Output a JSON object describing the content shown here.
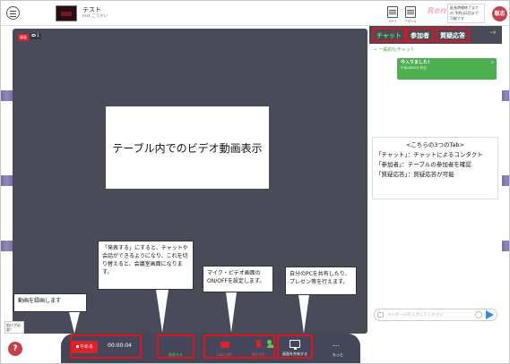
{
  "header": {
    "table_name": "テスト",
    "table_sub": "test ごうかい",
    "icon1_label": "ｱﾝｹｰﾄ",
    "icon2_label": "ﾌﾟﾛﾌｨｰﾙ",
    "logo": "Remo",
    "logo_sub": "",
    "notice": "延長時間終了まで の 予約は2回まで 可能です",
    "user_initial": "聡志"
  },
  "video": {
    "rec_tag": "録画",
    "viewer_count": "1",
    "display_text": "テーブル内でのビデオ動画表示"
  },
  "panel": {
    "tabs": [
      "チャット",
      "参加者",
      "質疑応答"
    ],
    "general_chat": "← 一般的なチャット",
    "bubble_message": "今入りました！",
    "bubble_time": "午後2時00分 昨日",
    "input_placeholder": "メッセージを入力してください",
    "callout_title": "<こちらの3つのTab>",
    "callout_lines": [
      "「チャット」：チャットによるコンタクト",
      "「参加者」：テーブルの参加者を確認",
      "「質疑応答」：質疑応答が可能"
    ]
  },
  "toolbar": {
    "stop_label": "やめる",
    "rec_time": "00:00:04",
    "present_label": "発表する",
    "cam_label": "Cam Off",
    "mic_label": "Mic Off",
    "screen_label": "画面を共有する",
    "more_label": "もっと"
  },
  "callouts": {
    "record": "動画を録画します",
    "present": "「発表する」にすると、チャットや会話ができるようになり、これを切り替えると、会議室画面になります。",
    "cam_mic": "マイク・ビデオ画面のON/OFFを設定します。",
    "share": "自分のPCを共有したり、プレゼン等を行えます。"
  },
  "side": {
    "help_label": "助けが必要？",
    "help_icon": "?"
  },
  "colors": {
    "video_bg": "#494b59",
    "toolbar_bg": "#44475a",
    "accent_red": "#e0141e",
    "accent_green": "#56d04a",
    "brand": "#c9404d"
  }
}
